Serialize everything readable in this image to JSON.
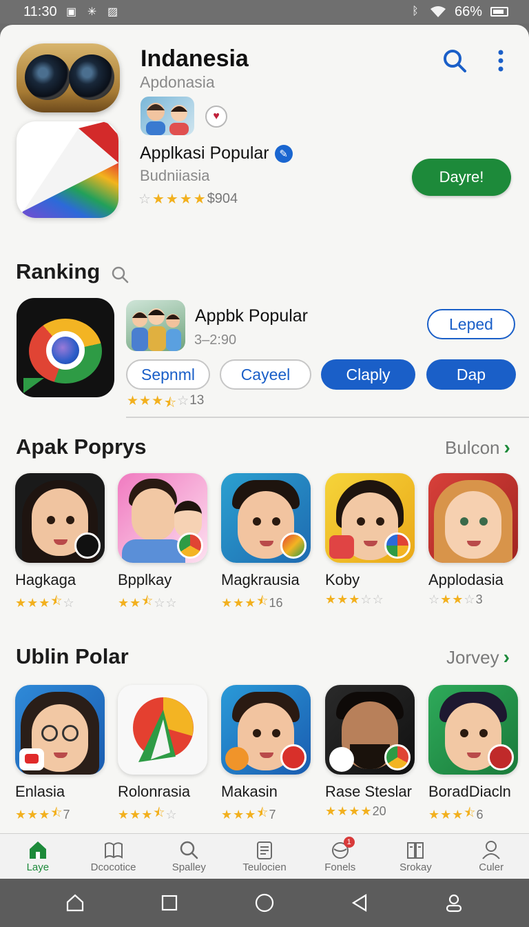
{
  "status_bar": {
    "time": "11:30",
    "battery": "66%"
  },
  "header": {
    "title": "Indanesia",
    "subtitle": "Apdonasia"
  },
  "featured": {
    "name": "Applkasi Popular",
    "developer": "Budniiasia",
    "rating_stars": 5,
    "rating_text": "$904",
    "install_label": "Dayre!"
  },
  "ranking": {
    "title": "Ranking",
    "item": {
      "name": "Appbk Popular",
      "sub": "3–2:90",
      "top_button": "Leped",
      "buttons": [
        "Sepnml",
        "Cayeel",
        "Claply",
        "Dap"
      ],
      "rating_stars": 3.5,
      "rating_count": "13"
    }
  },
  "section1": {
    "title": "Apak Poprys",
    "see_more": "Bulcon",
    "items": [
      {
        "label": "Hagkaga",
        "stars": 3.5,
        "count": ""
      },
      {
        "label": "Bpplkay",
        "stars": 2.5,
        "count": ""
      },
      {
        "label": "Magkrausia",
        "stars": 3.5,
        "count": "16"
      },
      {
        "label": "Koby",
        "stars": 3,
        "count": ""
      },
      {
        "label": "Applodasia",
        "stars": 3,
        "count": "3"
      }
    ]
  },
  "section2": {
    "title": "Ublin Polar",
    "see_more": "Jorvey",
    "items": [
      {
        "label": "Enlasia",
        "stars": 4,
        "count": "7"
      },
      {
        "label": "Rolonrasia",
        "stars": 3.5,
        "count": ""
      },
      {
        "label": "Makasin",
        "stars": 3.5,
        "count": "7"
      },
      {
        "label": "Rase Steslar",
        "stars": 4,
        "count": "20"
      },
      {
        "label": "BoradDiacln",
        "stars": 3.5,
        "count": "6"
      }
    ]
  },
  "bottom_nav": [
    {
      "label": "Laye",
      "icon": "home-icon",
      "active": true
    },
    {
      "label": "Dcocotice",
      "icon": "book-icon"
    },
    {
      "label": "Spalley",
      "icon": "search-icon"
    },
    {
      "label": "Teulocien",
      "icon": "document-icon"
    },
    {
      "label": "Fonels",
      "icon": "globe-icon",
      "badge": "1"
    },
    {
      "label": "Srokay",
      "icon": "books-icon"
    },
    {
      "label": "Culer",
      "icon": "user-icon"
    }
  ],
  "colors": {
    "accent_green": "#1d8a3a",
    "accent_blue": "#1a5fc8",
    "star": "#f2b01e"
  }
}
